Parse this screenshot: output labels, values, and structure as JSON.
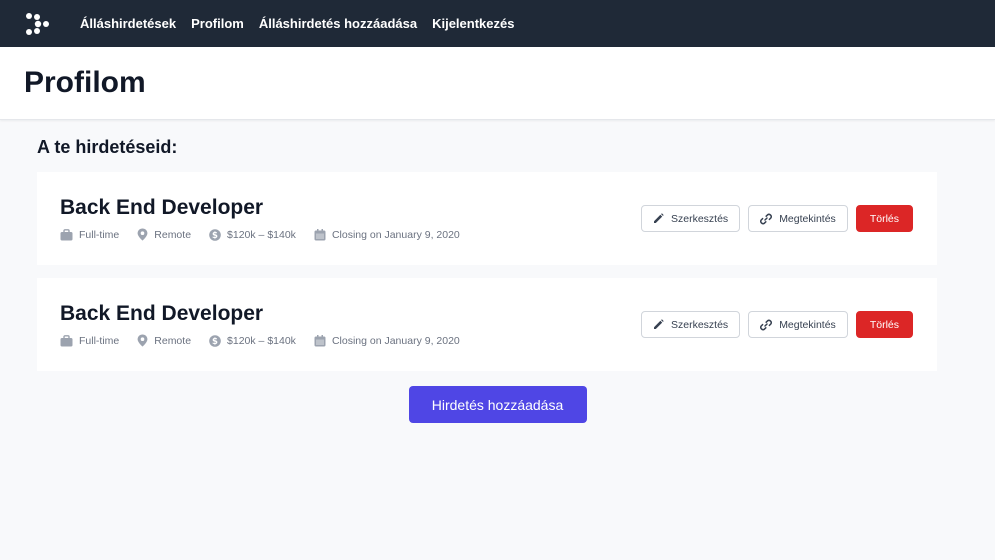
{
  "nav": {
    "items": [
      {
        "label": "Álláshirdetések"
      },
      {
        "label": "Profilom"
      },
      {
        "label": "Álláshirdetés hozzáadása"
      },
      {
        "label": "Kijelentkezés"
      }
    ]
  },
  "header": {
    "title": "Profilom"
  },
  "section": {
    "heading": "A te hirdetéseid:"
  },
  "jobs": [
    {
      "title": "Back End Developer",
      "type": "Full-time",
      "location": "Remote",
      "salary": "$120k – $140k",
      "closing": "Closing on January 9, 2020"
    },
    {
      "title": "Back End Developer",
      "type": "Full-time",
      "location": "Remote",
      "salary": "$120k – $140k",
      "closing": "Closing on January 9, 2020"
    }
  ],
  "actions": {
    "edit_label": "Szerkesztés",
    "view_label": "Megtekintés",
    "delete_label": "Törlés"
  },
  "add_button": {
    "label": "Hirdetés hozzáadása"
  },
  "colors": {
    "navbar": "#1f2937",
    "primary": "#4f46e5",
    "danger": "#dc2626",
    "background": "#f8f9fb"
  },
  "icons": [
    "logo-icon",
    "briefcase-icon",
    "location-pin-icon",
    "dollar-icon",
    "calendar-icon",
    "pencil-icon",
    "link-icon"
  ]
}
